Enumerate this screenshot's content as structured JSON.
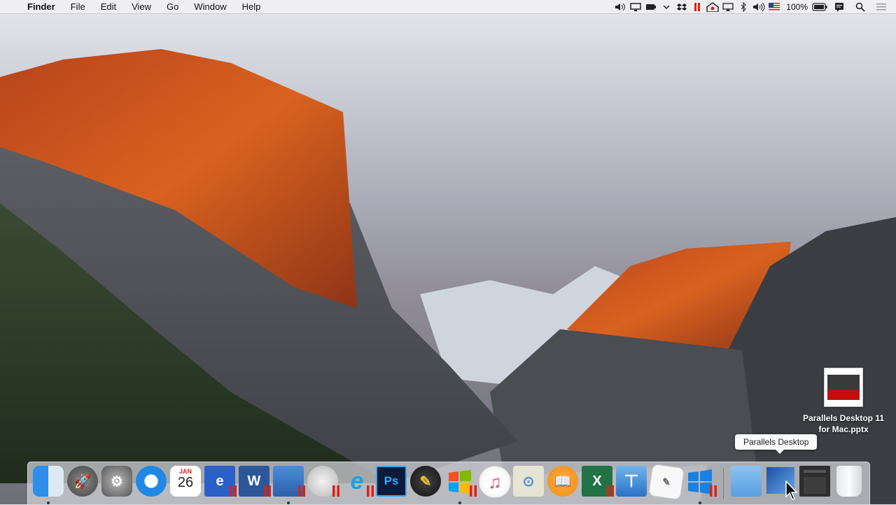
{
  "menubar": {
    "apple_glyph": "",
    "app_name": "Finder",
    "menus": [
      "File",
      "Edit",
      "View",
      "Go",
      "Window",
      "Help"
    ],
    "battery": "100%",
    "status_icons": [
      "speaker-icon",
      "display-icon",
      "battery-small-icon",
      "chevron-icon",
      "dropbox-icon",
      "parallels-icon",
      "home-icon",
      "airplay-icon",
      "bluetooth-icon",
      "volume-icon",
      "flag-icon",
      "battery-icon",
      "notification-icon",
      "search-icon",
      "list-icon"
    ]
  },
  "desktop": {
    "file_label": "Parallels Desktop 11 for Mac.pptx"
  },
  "tooltip": {
    "text": "Parallels Desktop"
  },
  "dock": {
    "items": [
      {
        "name": "finder",
        "color": "#2b8ae8"
      },
      {
        "name": "launchpad",
        "color": "#6b6b6b"
      },
      {
        "name": "system-preferences",
        "color": "#8a8a8a"
      },
      {
        "name": "safari",
        "color": "#1e88e5"
      },
      {
        "name": "calendar",
        "color": "#ffffff",
        "label": "26",
        "month": "JAN"
      },
      {
        "name": "windows-app-e",
        "color": "#2b5fc9",
        "label": "e"
      },
      {
        "name": "word",
        "color": "#2b579a",
        "label": "W"
      },
      {
        "name": "windows-screen",
        "color": "#3d7fd6"
      },
      {
        "name": "boot-camp-apple",
        "color": "#d8d8d8"
      },
      {
        "name": "internet-explorer",
        "color": "#1ba1e2",
        "label": "e"
      },
      {
        "name": "photoshop",
        "color": "#0c1b3a",
        "label": "Ps"
      },
      {
        "name": "pencil-app",
        "color": "#303030"
      },
      {
        "name": "windows-flag",
        "color": "#e8e8e8"
      },
      {
        "name": "itunes",
        "color": "#f2f2f2"
      },
      {
        "name": "image-tool",
        "color": "#e6e4d2"
      },
      {
        "name": "ibooks",
        "color": "#f28a1a"
      },
      {
        "name": "excel",
        "color": "#217346",
        "label": "X"
      },
      {
        "name": "keynote",
        "color": "#3d8ee0"
      },
      {
        "name": "textedit",
        "color": "#f4f4f4"
      },
      {
        "name": "windows-10",
        "color": "#1b80e0"
      },
      {
        "name": "downloads-folder",
        "color": "#6aaee8"
      },
      {
        "name": "parallels-desktop",
        "color": "#3b78c8"
      },
      {
        "name": "window-stack",
        "color": "#2e2e2e"
      },
      {
        "name": "trash",
        "color": "#e4e6ea"
      }
    ]
  }
}
